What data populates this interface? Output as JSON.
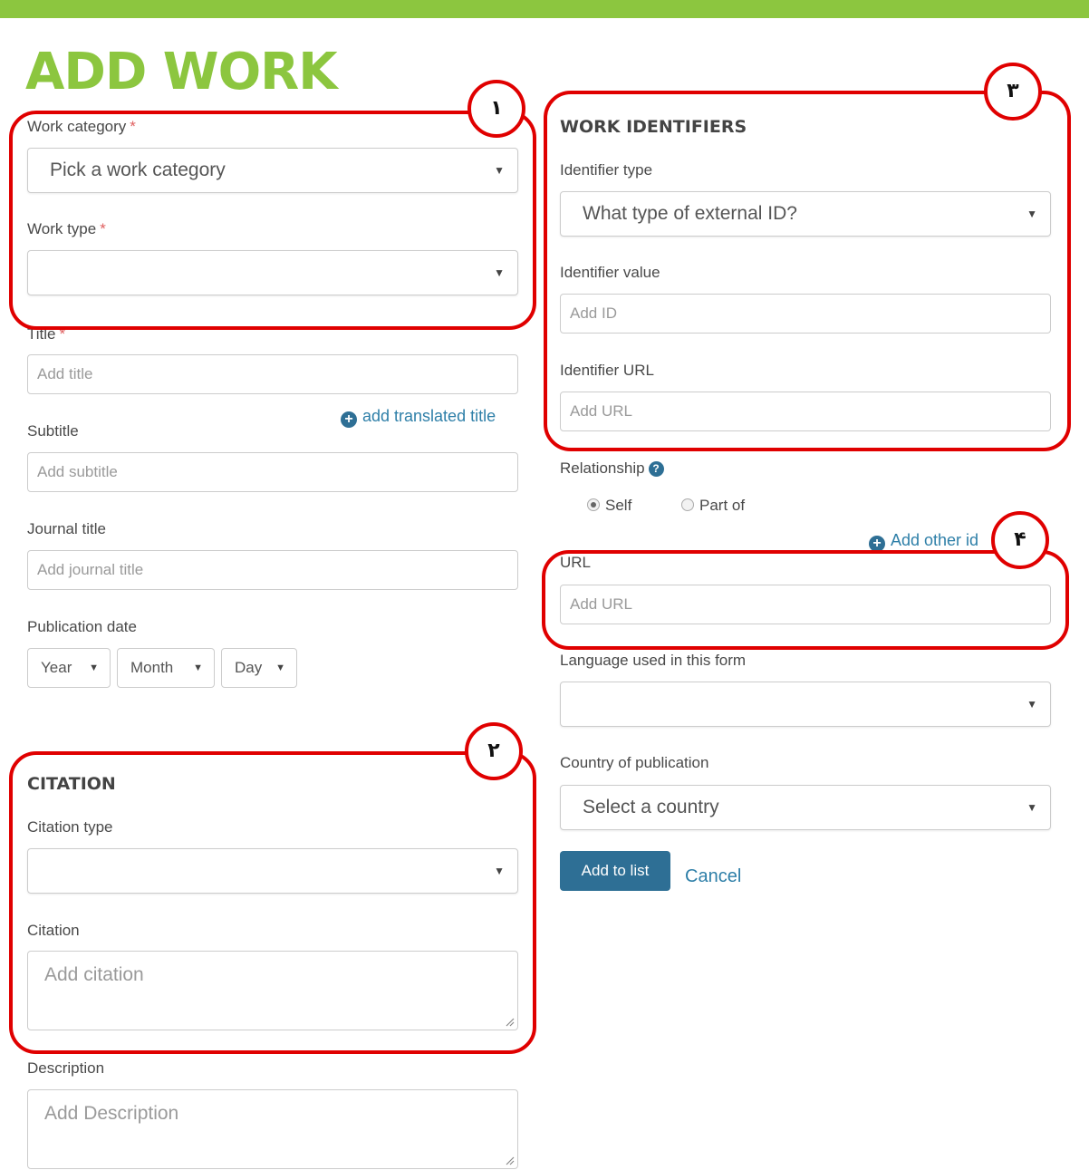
{
  "page": {
    "title": "ADD WORK",
    "accent_color": "#8cc63f",
    "link_color": "#2e7fa8",
    "primary_color": "#2e6f95",
    "annotation_color": "#e00000"
  },
  "left": {
    "work_category": {
      "label": "Work category",
      "required_mark": "*",
      "value": "Pick a work category"
    },
    "work_type": {
      "label": "Work type",
      "required_mark": "*",
      "value": ""
    },
    "title": {
      "label": "Title",
      "required_mark": "*",
      "placeholder": "Add title",
      "add_translated_label": "add translated title"
    },
    "subtitle": {
      "label": "Subtitle",
      "placeholder": "Add subtitle"
    },
    "journal_title": {
      "label": "Journal title",
      "placeholder": "Add journal title"
    },
    "publication_date": {
      "label": "Publication date",
      "year": "Year",
      "month": "Month",
      "day": "Day"
    },
    "citation_section": {
      "heading": "CITATION",
      "citation_type": {
        "label": "Citation type",
        "value": ""
      },
      "citation": {
        "label": "Citation",
        "placeholder": "Add citation"
      }
    },
    "description": {
      "label": "Description",
      "placeholder": "Add Description"
    }
  },
  "right": {
    "identifiers_section": {
      "heading": "WORK IDENTIFIERS",
      "identifier_type": {
        "label": "Identifier type",
        "value": "What type of external ID?"
      },
      "identifier_value": {
        "label": "Identifier value",
        "placeholder": "Add ID"
      },
      "identifier_url": {
        "label": "Identifier URL",
        "placeholder": "Add URL"
      }
    },
    "relationship": {
      "label": "Relationship",
      "options": [
        "Self",
        "Part of"
      ],
      "selected": "Self"
    },
    "add_other_identifier": "Add other id",
    "url": {
      "label": "URL",
      "placeholder": "Add URL"
    },
    "language": {
      "label": "Language used in this form",
      "value": ""
    },
    "country": {
      "label": "Country of publication",
      "value": "Select a country"
    },
    "actions": {
      "add_label": "Add to list",
      "cancel_label": "Cancel"
    }
  },
  "annotations": [
    "١",
    "٢",
    "٣",
    "۴"
  ]
}
